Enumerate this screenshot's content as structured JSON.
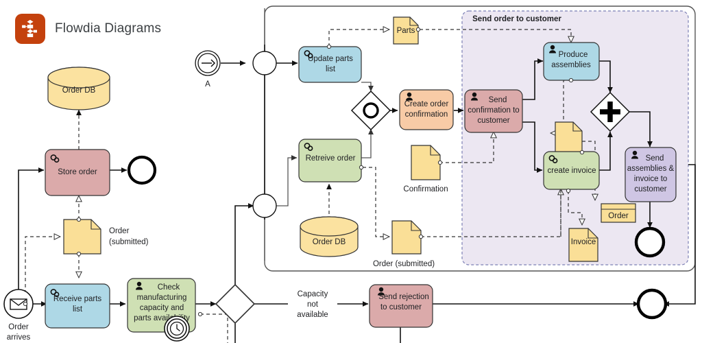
{
  "app": {
    "title": "Flowdia Diagrams",
    "logo_icon": "flowchart-logo-icon",
    "logo_color": "#c4410d"
  },
  "palette": {
    "task_blue": "#aed8e6",
    "task_green": "#cfe0b4",
    "task_red": "#dbaaaa",
    "task_orange": "#f8cba6",
    "task_purple": "#cfc6e4",
    "data_yellow": "#fadf97",
    "db_yellow": "#fbe2a0",
    "subprocess_fill": "#ece7f2",
    "subprocess_stroke": "#7b7fb5",
    "stroke": "#333333"
  },
  "diagram": {
    "events": [
      {
        "id": "start_order",
        "name": "message-start-event",
        "label": "Order\narrives",
        "icon": "envelope-icon",
        "label_line1": "Order",
        "label_line2": "arrives"
      },
      {
        "id": "link_a",
        "name": "link-intermediate-event",
        "label": "A",
        "icon": "arrow-right-icon"
      },
      {
        "id": "end_store",
        "name": "end-event-store-order",
        "label": ""
      },
      {
        "id": "end_subproc",
        "name": "end-event-subprocess",
        "label": ""
      },
      {
        "id": "end_main",
        "name": "end-event-main",
        "label": ""
      },
      {
        "id": "timer_boundary",
        "name": "timer-boundary-event",
        "label": "",
        "icon": "clock-icon"
      }
    ],
    "gateways": [
      {
        "id": "gw_merge_top",
        "name": "merge-circle-gateway-top",
        "kind": "circle"
      },
      {
        "id": "gw_merge_bot",
        "name": "merge-circle-gateway-bottom",
        "kind": "circle"
      },
      {
        "id": "gw_event",
        "name": "event-based-gateway",
        "kind": "event",
        "symbol": "circle"
      },
      {
        "id": "gw_parallel",
        "name": "parallel-gateway",
        "kind": "parallel",
        "symbol": "plus"
      },
      {
        "id": "gw_exclusive",
        "name": "exclusive-gateway-capacity",
        "kind": "exclusive"
      }
    ],
    "tasks": [
      {
        "id": "store_order",
        "name": "task-store-order",
        "label": "Store order",
        "lines": [
          "Store order"
        ],
        "type": "service",
        "icon": "gears-icon",
        "color": "task_red"
      },
      {
        "id": "receive_parts",
        "name": "task-receive-parts-list",
        "label": "Receive parts list",
        "lines": [
          "Receive parts",
          "list"
        ],
        "type": "service",
        "icon": "gears-icon",
        "color": "task_blue"
      },
      {
        "id": "check_mfg",
        "name": "task-check-manufacturing",
        "label": "Check manufacturing capacity and parts availability",
        "lines": [
          "Check",
          "manufacturing",
          "capacity and",
          "parts availability"
        ],
        "type": "user",
        "icon": "user-icon",
        "color": "task_green"
      },
      {
        "id": "update_parts",
        "name": "task-update-parts-list",
        "label": "Update parts list",
        "lines": [
          "Update parts",
          "list"
        ],
        "type": "service",
        "icon": "gears-icon",
        "color": "task_blue"
      },
      {
        "id": "retrieve_order",
        "name": "task-retreive-order",
        "label": "Retreive order",
        "lines": [
          "Retreive order"
        ],
        "type": "service",
        "icon": "gears-icon",
        "color": "task_green"
      },
      {
        "id": "create_conf",
        "name": "task-create-order-confirmation",
        "label": "Create order confirmation",
        "lines": [
          "Create order",
          "confirmation"
        ],
        "type": "user",
        "icon": "user-icon",
        "color": "task_orange"
      },
      {
        "id": "send_conf",
        "name": "task-send-confirmation-to-customer",
        "label": "Send confirmation to customer",
        "lines": [
          "Send",
          "confirmation to",
          "customer"
        ],
        "type": "user",
        "icon": "user-icon",
        "color": "task_red"
      },
      {
        "id": "produce_asm",
        "name": "task-produce-assemblies",
        "label": "Produce assemblies",
        "lines": [
          "Produce",
          "assemblies"
        ],
        "type": "user",
        "icon": "user-icon",
        "color": "task_blue"
      },
      {
        "id": "create_invoice",
        "name": "task-create-invoice",
        "label": "create invoice",
        "lines": [
          "create invoice"
        ],
        "type": "service",
        "icon": "gears-icon",
        "color": "task_green"
      },
      {
        "id": "send_asm_inv",
        "name": "task-send-assemblies-invoice",
        "label": "Send assemblies & invoice to customer",
        "lines": [
          "Send",
          "assemblies &",
          "invoice to",
          "customer"
        ],
        "type": "user",
        "icon": "user-icon",
        "color": "task_purple"
      },
      {
        "id": "send_rejection",
        "name": "task-send-rejection-to-customer",
        "label": "Send rejection to customer",
        "lines": [
          "Send rejection",
          "to customer"
        ],
        "type": "user",
        "icon": "user-icon",
        "color": "task_red"
      }
    ],
    "data_objects": [
      {
        "id": "do_order_sub_left",
        "name": "data-object-order-submitted-left",
        "label": "Order (submitted)",
        "lines": [
          "Order",
          "(submitted)"
        ],
        "label_pos": "right"
      },
      {
        "id": "do_parts",
        "name": "data-object-parts",
        "label": "Parts",
        "lines": [
          "Parts"
        ],
        "label_pos": "inside"
      },
      {
        "id": "do_confirmation",
        "name": "data-object-confirmation",
        "label": "Confirmation",
        "lines": [
          "Confirmation"
        ],
        "label_pos": "below"
      },
      {
        "id": "do_order_sub_mid",
        "name": "data-object-order-submitted-mid",
        "label": "Order (submitted)",
        "lines": [
          "Order (submitted)"
        ],
        "label_pos": "below"
      },
      {
        "id": "do_invoice",
        "name": "data-object-invoice",
        "label": "Invoice",
        "lines": [
          "Invoice"
        ],
        "label_pos": "inside"
      },
      {
        "id": "do_blank_sub",
        "name": "data-object-unlabeled",
        "label": "",
        "lines": [],
        "label_pos": "none"
      }
    ],
    "data_stores": [
      {
        "id": "db_top",
        "name": "data-store-order-db-top",
        "label": "Order DB"
      },
      {
        "id": "db_mid",
        "name": "data-store-order-db-middle",
        "label": "Order DB"
      }
    ],
    "artifacts": [
      {
        "id": "art_order",
        "name": "data-store-order-box",
        "label": "Order"
      }
    ],
    "containers": [
      {
        "id": "outer_pool",
        "name": "outer-process-container",
        "label": ""
      },
      {
        "id": "subprocess",
        "name": "subprocess-send-order-to-customer",
        "label": "Send order to customer"
      }
    ],
    "flow_labels": [
      {
        "id": "lbl_capacity",
        "name": "flow-label-capacity-not-available",
        "lines": [
          "Capacity",
          "not",
          "available"
        ],
        "label": "Capacity not available"
      }
    ]
  }
}
